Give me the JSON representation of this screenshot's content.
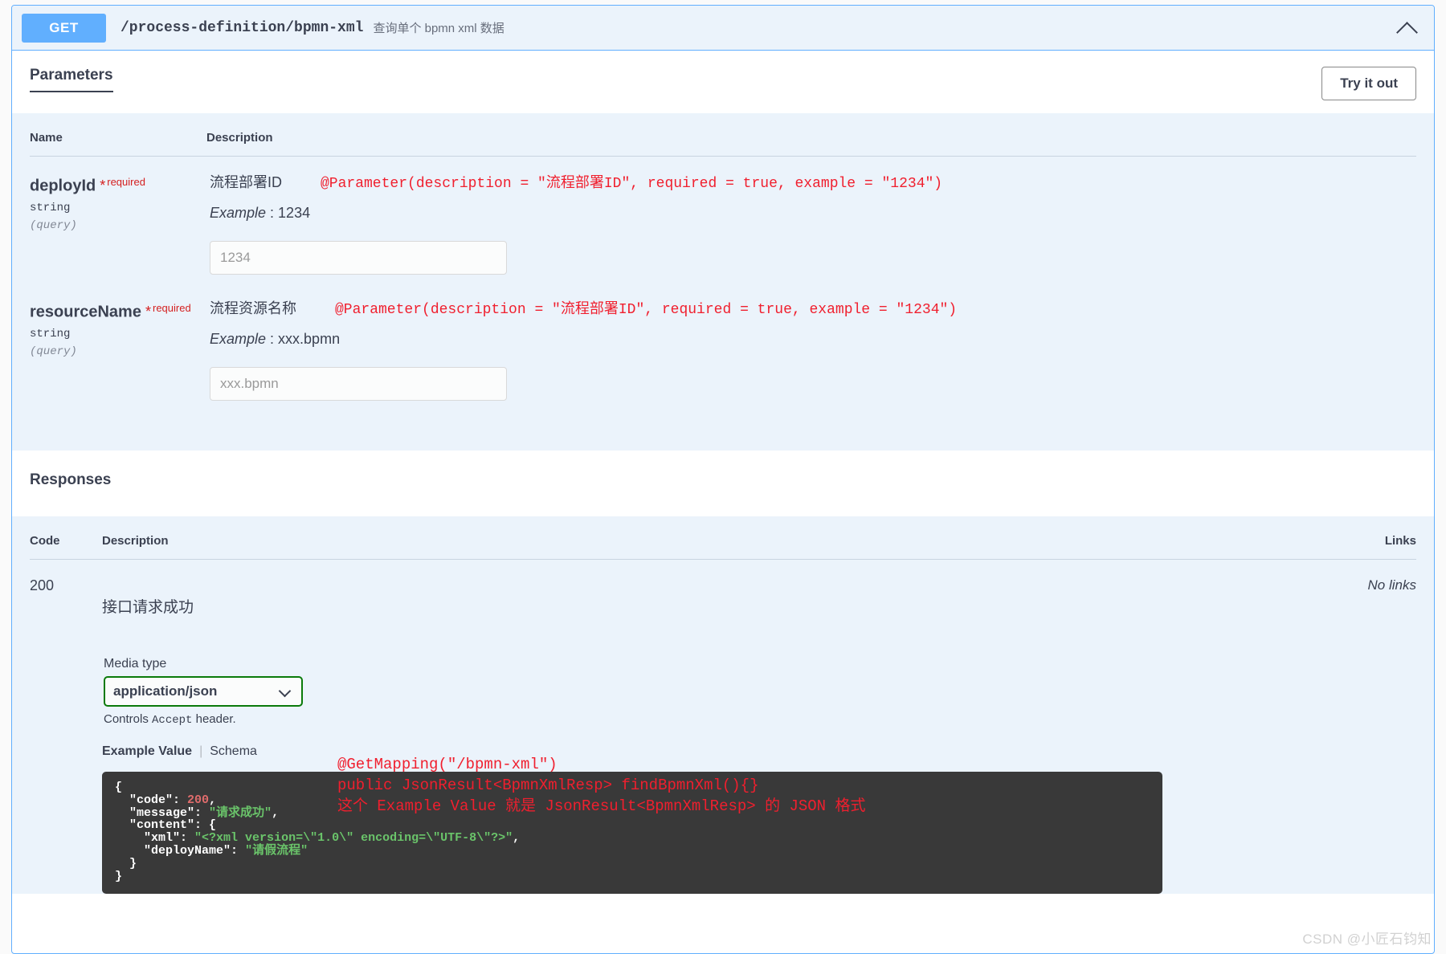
{
  "operation": {
    "method": "GET",
    "path": "/process-definition/bpmn-xml",
    "summary": "查询单个 bpmn xml 数据",
    "collapse_icon": "chevron-up-icon"
  },
  "parameters_section": {
    "title": "Parameters",
    "try_it_out_label": "Try it out",
    "columns": {
      "name": "Name",
      "description": "Description"
    },
    "rows": [
      {
        "name": "deployId",
        "required_star": "*",
        "required_label": "required",
        "type": "string",
        "in": "(query)",
        "description_cn": "流程部署ID",
        "annotation": "@Parameter(description = \"流程部署ID\", required = true, example = \"1234\")",
        "example_label": "Example",
        "example_value": "1234",
        "input_value": "",
        "input_placeholder": "1234"
      },
      {
        "name": "resourceName",
        "required_star": "*",
        "required_label": "required",
        "type": "string",
        "in": "(query)",
        "description_cn": "流程资源名称",
        "annotation": "@Parameter(description = \"流程部署ID\", required = true, example = \"1234\")",
        "example_label": "Example",
        "example_value": "xxx.bpmn",
        "input_value": "",
        "input_placeholder": "xxx.bpmn"
      }
    ]
  },
  "responses_section": {
    "title": "Responses",
    "columns": {
      "code": "Code",
      "description": "Description",
      "links": "Links"
    },
    "rows": [
      {
        "code": "200",
        "description_cn": "接口请求成功",
        "links": "No links",
        "media_type_label": "Media type",
        "media_type_value": "application/json",
        "media_caret_icon": "chevron-down-icon",
        "accept_note_prefix": "Controls ",
        "accept_note_mono": "Accept",
        "accept_note_suffix": " header.",
        "example_value_tab": "Example Value",
        "schema_tab": "Schema",
        "example_json": "{\n  \"code\": 200,\n  \"message\": \"请求成功\",\n  \"content\": {\n    \"xml\": \"<?xml version=\\\"1.0\\\" encoding=\\\"UTF-8\\\"?>\",\n    \"deployName\": \"请假流程\"\n  }\n}"
      }
    ],
    "annotation_lines": [
      "@GetMapping(\"/bpmn-xml\")",
      "public JsonResult<BpmnXmlResp> findBpmnXml(){}",
      "这个 Example Value 就是 JsonResult<BpmnXmlResp> 的 JSON 格式"
    ]
  },
  "watermark": "CSDN @小匠石钧知",
  "colors": {
    "method_blue": "#61affe",
    "panel_tint": "#ebf3fb",
    "annotation_red": "#f01f2e",
    "required_red": "#d41f1f",
    "media_green": "#0a7a0a",
    "code_bg": "#393939",
    "text": "#3b4151"
  }
}
